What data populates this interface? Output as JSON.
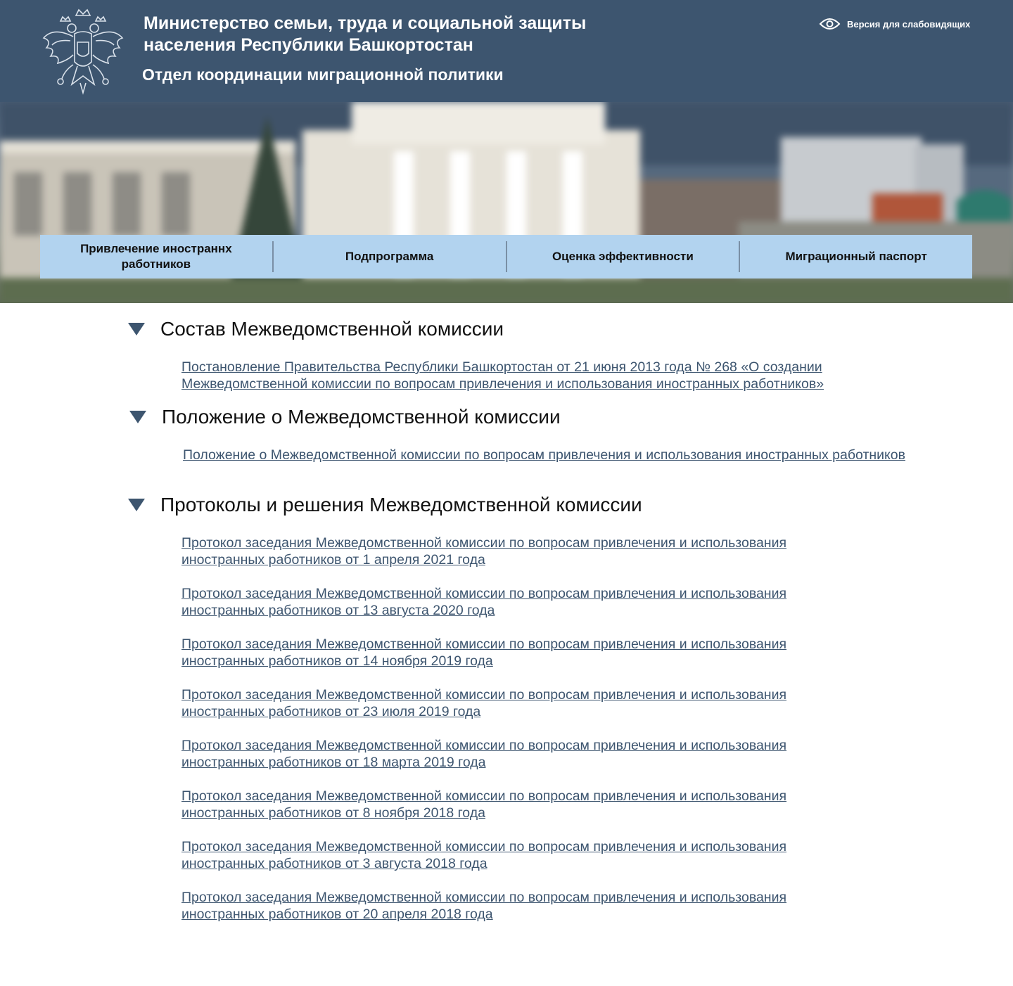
{
  "header": {
    "ministry_title": "Министерство семьи, труда и социальной защиты населения Республики Башкортостан",
    "department_title": "Отдел координации миграционной политики",
    "accessibility_label": "Версия для слабовидящих"
  },
  "nav": {
    "items": [
      {
        "label": "Привлечение иностраннх работников"
      },
      {
        "label": "Подпрограмма"
      },
      {
        "label": "Оценка эффективности"
      },
      {
        "label": "Миграционный паспорт"
      }
    ]
  },
  "sections": [
    {
      "title": "Состав Межведомственной комиссии",
      "links": [
        "Постановление Правительства Республики Башкортостан от 21 июня 2013 года № 268 «О создании Межведомственной комиссии по вопросам привлечения и использования иностранных работников»"
      ]
    },
    {
      "title": "Положение о Межведомственной комиссии",
      "links": [
        "Положение  о Межведомственной комиссии по вопросам привлечения и использования иностранных работников"
      ]
    },
    {
      "title": "Протоколы и решения Межведомственной комиссии",
      "links": [
        "Протокол заседания Межведомственной комиссии по вопросам привлечения и использования иностранных работников от 1 апреля 2021 года",
        "Протокол заседания Межведомственной комиссии по вопросам привлечения и использования иностранных работников от 13 августа 2020 года",
        "Протокол заседания Межведомственной комиссии по вопросам привлечения и использования иностранных работников от 14 ноября 2019 года",
        "Протокол заседания Межведомственной комиссии по вопросам привлечения и использования иностранных работников от 23 июля 2019 года",
        "Протокол заседания Межведомственной комиссии по вопросам привлечения и использования иностранных работников от 18 марта 2019 года",
        "Протокол заседания Межведомственной комиссии по вопросам привлечения и использования иностранных работников от 8 ноября 2018 года",
        "Протокол заседания Межведомственной комиссии по вопросам привлечения и использования иностранных работников от 3 августа 2018 года",
        "Протокол заседания Межведомственной комиссии по вопросам привлечения и использования иностранных работников от 20 апреля 2018 года"
      ]
    }
  ],
  "colors": {
    "header_bg": "#3d556f",
    "nav_bg": "#b2d3ef",
    "link": "#3d556f"
  },
  "icons": {
    "emblem": "coat-of-arms-icon",
    "accessibility": "eye-icon",
    "section_toggle": "triangle-down-icon"
  }
}
